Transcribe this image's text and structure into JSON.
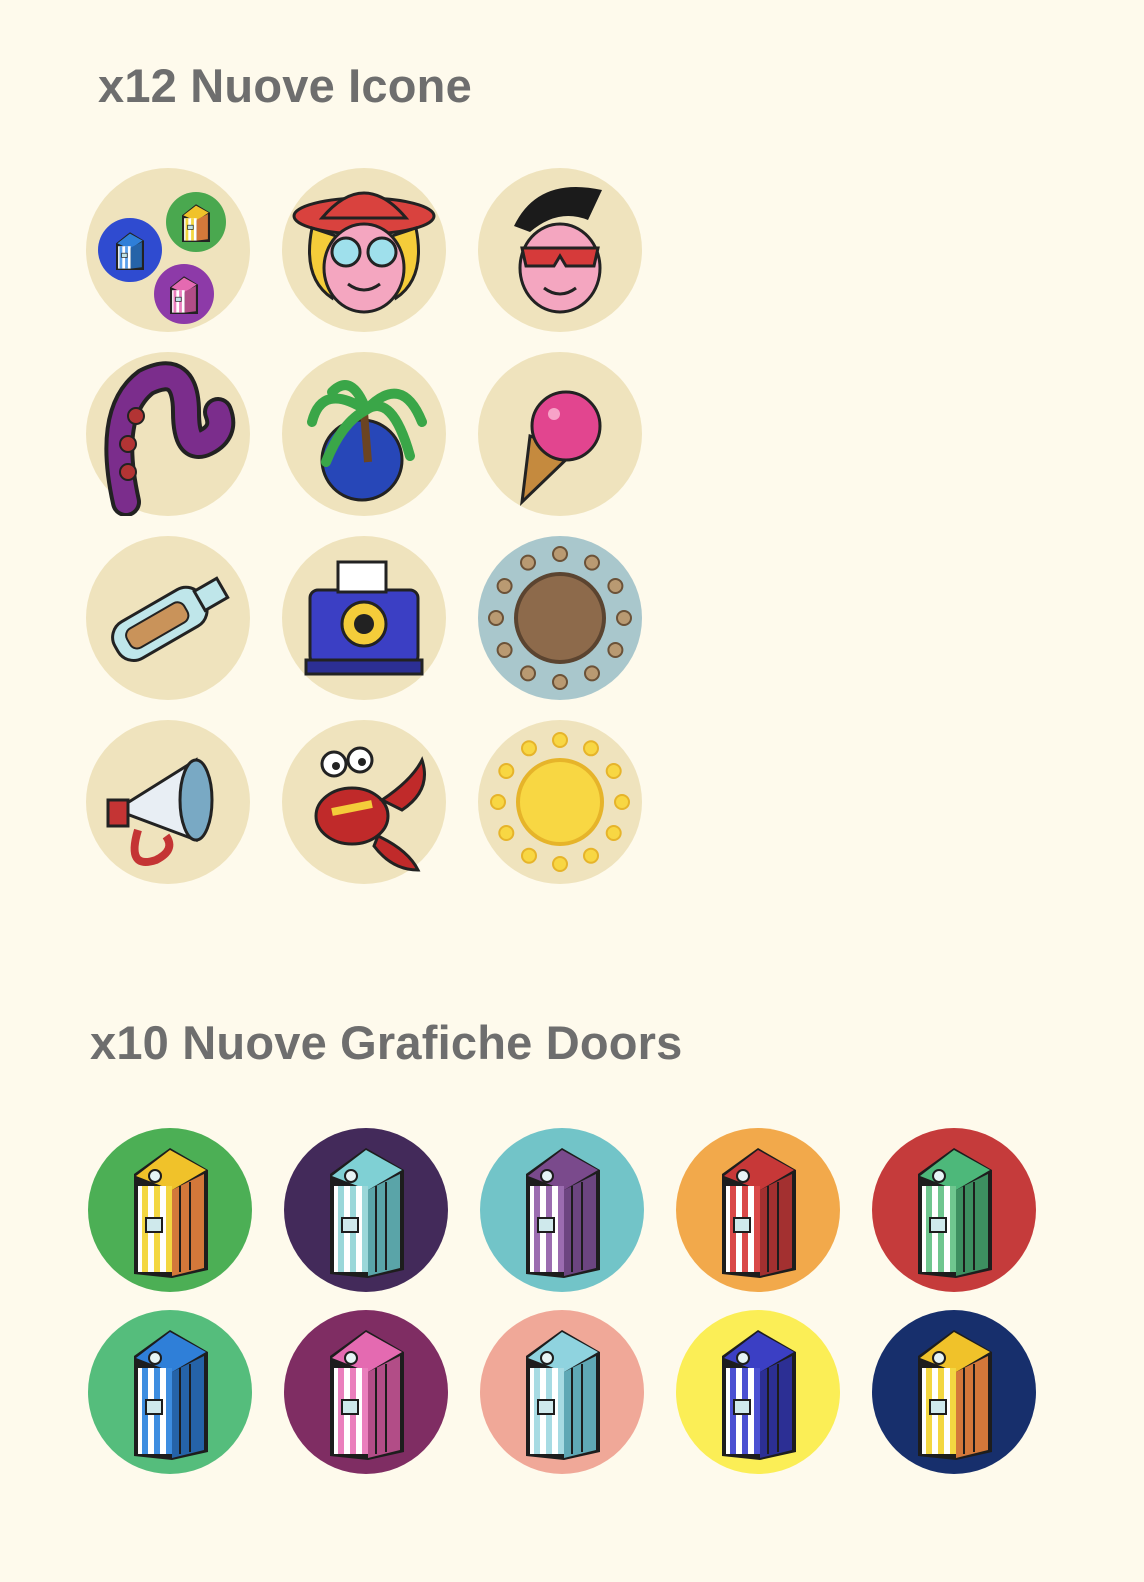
{
  "sections": {
    "icons": {
      "title": "x12 Nuove Icone",
      "items": [
        {
          "icon": "beach-huts-trio-icon",
          "bg": "#efe3bd"
        },
        {
          "icon": "girl-sunhat-icon",
          "bg": "#efe3bd"
        },
        {
          "icon": "boy-sunglasses-icon",
          "bg": "#efe3bd"
        },
        {
          "icon": "octopus-tentacle-icon",
          "bg": "#efe3bd"
        },
        {
          "icon": "palm-island-icon",
          "bg": "#efe3bd"
        },
        {
          "icon": "ice-cream-cone-icon",
          "bg": "#efe3bd"
        },
        {
          "icon": "message-bottle-icon",
          "bg": "#efe3bd"
        },
        {
          "icon": "instant-camera-icon",
          "bg": "#efe3bd"
        },
        {
          "icon": "shell-ring-icon",
          "bg": "#a9c7cc"
        },
        {
          "icon": "megaphone-icon",
          "bg": "#efe3bd"
        },
        {
          "icon": "crab-icon",
          "bg": "#efe3bd"
        },
        {
          "icon": "sun-icon",
          "bg": "#efe3bd"
        }
      ]
    },
    "doors": {
      "title": "x10 Nuove Grafiche Doors",
      "items": [
        {
          "icon": "beach-hut-door-icon",
          "bg": "#4caf55",
          "roof": "#f0c22a",
          "stripe": "#f3d741",
          "side": "#d3783a"
        },
        {
          "icon": "beach-hut-door-icon",
          "bg": "#432a5a",
          "roof": "#7fd0d4",
          "stripe": "#9ad7d9",
          "side": "#5aa4a8"
        },
        {
          "icon": "beach-hut-door-icon",
          "bg": "#72c4c8",
          "roof": "#7a4a8c",
          "stripe": "#9b6cb0",
          "side": "#6c4580"
        },
        {
          "icon": "beach-hut-door-icon",
          "bg": "#f2a94b",
          "roof": "#c73838",
          "stripe": "#d94848",
          "side": "#a33030"
        },
        {
          "icon": "beach-hut-door-icon",
          "bg": "#c53b3b",
          "roof": "#4db87a",
          "stripe": "#6fc68f",
          "side": "#3d8f60"
        },
        {
          "icon": "beach-hut-door-icon",
          "bg": "#55bd7c",
          "roof": "#2f7fd8",
          "stripe": "#3d8de0",
          "side": "#2563a8"
        },
        {
          "icon": "beach-hut-door-icon",
          "bg": "#7f2d63",
          "roof": "#e46ab1",
          "stripe": "#ea7fbd",
          "side": "#b24d87"
        },
        {
          "icon": "beach-hut-door-icon",
          "bg": "#f0a898",
          "roof": "#8fd3df",
          "stripe": "#a7dbe3",
          "side": "#5fa8b5"
        },
        {
          "icon": "beach-hut-door-icon",
          "bg": "#fbee56",
          "roof": "#3b3fc4",
          "stripe": "#4b50d2",
          "side": "#2c2f94"
        },
        {
          "icon": "beach-hut-door-icon",
          "bg": "#172f6c",
          "roof": "#f0c22a",
          "stripe": "#f3d741",
          "side": "#d3783a"
        }
      ]
    }
  }
}
